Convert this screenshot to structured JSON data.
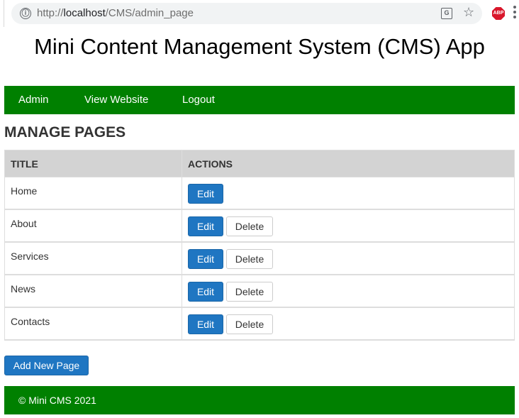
{
  "browser": {
    "url_prefix": "http://",
    "url_host": "localhost",
    "url_path": "/CMS/admin_page",
    "info_icon": "ⓘ",
    "translate_icon": "G",
    "star_icon": "☆",
    "abp_label": "ABP"
  },
  "page": {
    "title": "Mini Content Management System (CMS) App"
  },
  "nav": {
    "items": [
      {
        "label": "Admin"
      },
      {
        "label": "View Website"
      },
      {
        "label": "Logout"
      }
    ],
    "background": "#008000"
  },
  "manage": {
    "heading": "MANAGE PAGES",
    "columns": [
      "TITLE",
      "ACTIONS"
    ],
    "edit_label": "Edit",
    "delete_label": "Delete",
    "rows": [
      {
        "title": "Home",
        "deletable": false
      },
      {
        "title": "About",
        "deletable": true
      },
      {
        "title": "Services",
        "deletable": true
      },
      {
        "title": "News",
        "deletable": true
      },
      {
        "title": "Contacts",
        "deletable": true
      }
    ],
    "add_label": "Add New Page"
  },
  "footer": {
    "text": "© Mini CMS 2021"
  },
  "colors": {
    "green": "#008000",
    "primary": "#1f76c2",
    "header_row": "#d3d3d3"
  }
}
